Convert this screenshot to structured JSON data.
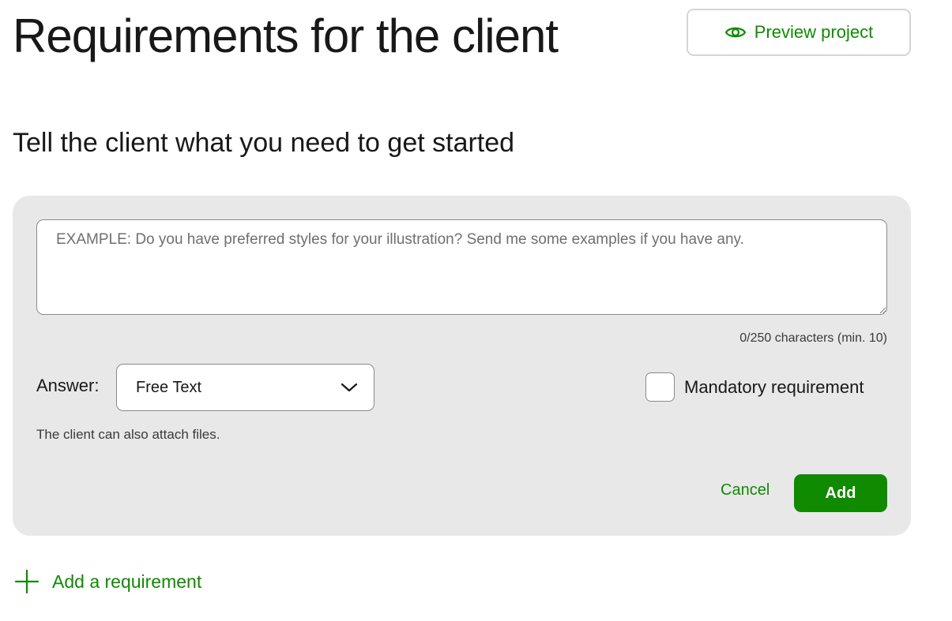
{
  "header": {
    "title": "Requirements for the client",
    "preview_label": "Preview project",
    "preview_icon": "eye-icon"
  },
  "section": {
    "title": "Tell the client what you need to get started"
  },
  "form": {
    "textarea_value": "",
    "textarea_placeholder": "EXAMPLE: Do you have preferred styles for your illustration? Send me some examples if you have any.",
    "char_count": "0/250 characters (min. 10)",
    "answer_label": "Answer:",
    "answer_type_selected": "Free Text",
    "mandatory_label": "Mandatory requirement",
    "mandatory_checked": false,
    "attach_note": "The client can also attach files.",
    "cancel_label": "Cancel",
    "add_label": "Add"
  },
  "footer": {
    "add_requirement_label": "Add a requirement",
    "add_icon": "plus-icon"
  },
  "colors": {
    "accent": "#108a00",
    "card_bg": "#e8e8e8",
    "text": "#181818"
  }
}
